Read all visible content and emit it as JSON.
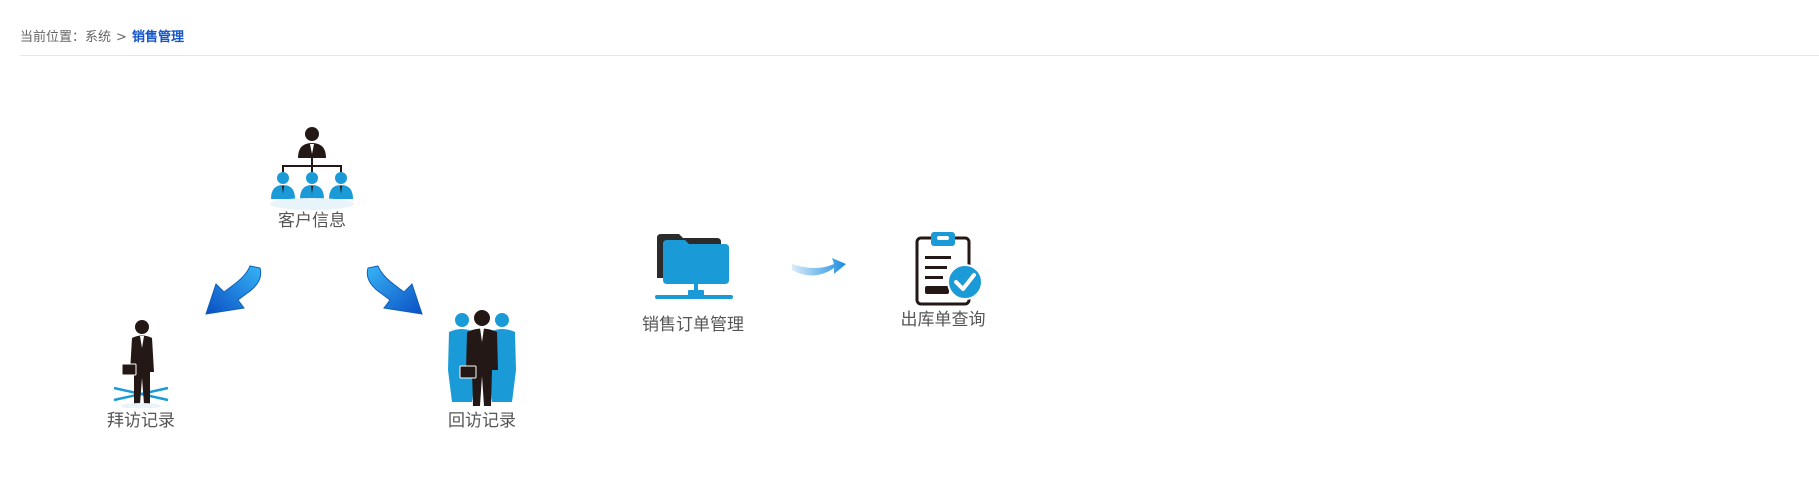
{
  "breadcrumb": {
    "prefix": "当前位置：",
    "system": "系统",
    "separator": ">",
    "current": "销售管理"
  },
  "modules": {
    "customer_info": {
      "label": "客户信息",
      "icon": "org-chart-icon"
    },
    "visit_record": {
      "label": "拜访记录",
      "icon": "businessman-icon"
    },
    "return_visit_record": {
      "label": "回访记录",
      "icon": "team-icon"
    },
    "sales_order": {
      "label": "销售订单管理",
      "icon": "network-folder-icon"
    },
    "outbound_query": {
      "label": "出库单查询",
      "icon": "clipboard-check-icon"
    }
  },
  "colors": {
    "accent_blue": "#1a9ad6",
    "arrow_blue": "#1e6fd9",
    "breadcrumb_current": "#1557c9",
    "icon_dark": "#231815"
  }
}
